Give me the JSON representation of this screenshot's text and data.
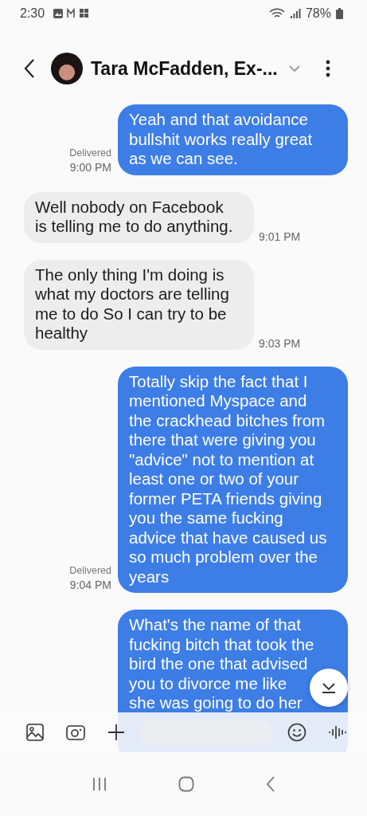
{
  "status_bar": {
    "time": "2:30",
    "battery": "78%"
  },
  "header": {
    "title": "Tara McFadden, Ex-..."
  },
  "messages": [
    {
      "kind": "sent",
      "text": "Yeah and that avoidance bullshit works really great as we can see.",
      "status": "Delivered",
      "time": "9:00 PM"
    },
    {
      "kind": "received",
      "text": "Well nobody on Facebook is telling me to do anything.",
      "time": "9:01 PM"
    },
    {
      "kind": "received",
      "text": "The only thing I'm doing is what my doctors are telling me to do So I can try to be healthy",
      "time": "9:03 PM"
    },
    {
      "kind": "sent",
      "text": "Totally skip the fact that I mentioned Myspace and the crackhead bitches from there that were giving you \"advice\" not to mention at least one or two of your former PETA friends giving you the same fucking advice that have caused us so much problem over the years",
      "status": "Delivered",
      "time": "9:04 PM"
    },
    {
      "kind": "sent",
      "text": "What's the name of that fucking bitch that took the bird the one that advised you to divorce me like she was going to do her"
    }
  ]
}
